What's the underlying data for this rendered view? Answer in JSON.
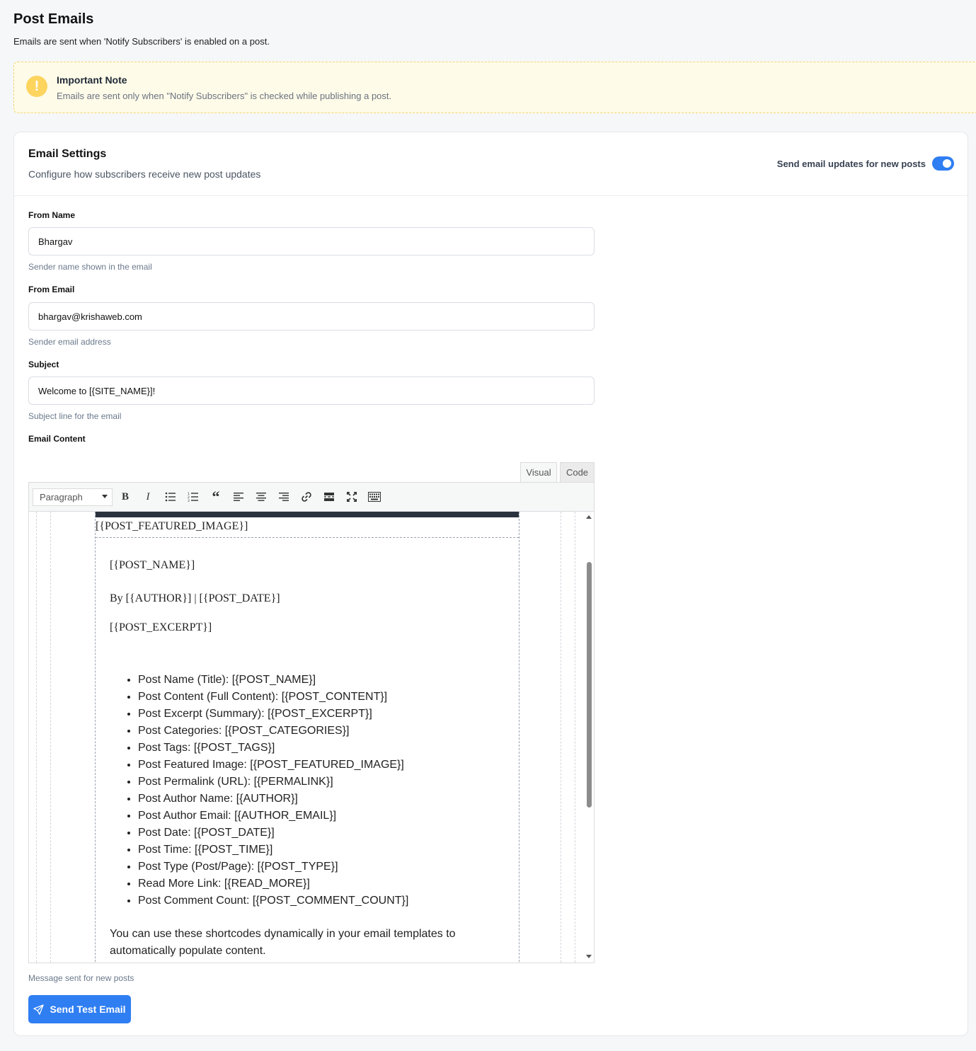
{
  "page": {
    "title": "Post Emails",
    "subtitle": "Emails are sent when 'Notify Subscribers' is enabled on a post."
  },
  "note": {
    "icon": "exclamation-icon",
    "title": "Important Note",
    "text": "Emails are sent only when \"Notify Subscribers\" is checked while publishing a post."
  },
  "settings": {
    "title": "Email Settings",
    "subtitle": "Configure how subscribers receive new post updates",
    "toggle_label": "Send email updates for new posts",
    "toggle_on": true,
    "from_name": {
      "label": "From Name",
      "value": "Bhargav",
      "help": "Sender name shown in the email"
    },
    "from_email": {
      "label": "From Email",
      "value": "bhargav@krishaweb.com",
      "help": "Sender email address"
    },
    "subject": {
      "label": "Subject",
      "value": "Welcome to [{SITE_NAME}]!",
      "help": "Subject line for the email"
    },
    "content": {
      "label": "Email Content",
      "help": "Message sent for new posts"
    }
  },
  "editor": {
    "tabs": {
      "visual": "Visual",
      "code": "Code"
    },
    "format_select": "Paragraph",
    "featured_image": "[{POST_FEATURED_IMAGE}]",
    "post_name": "[{POST_NAME}]",
    "byline": "By [{AUTHOR}] | [{POST_DATE}]",
    "excerpt": "[{POST_EXCERPT}]",
    "shortcodes": [
      "Post Name (Title): [{POST_NAME}]",
      "Post Content (Full Content): [{POST_CONTENT}]",
      "Post Excerpt (Summary): [{POST_EXCERPT}]",
      "Post Categories: [{POST_CATEGORIES}]",
      "Post Tags: [{POST_TAGS}]",
      "Post Featured Image: [{POST_FEATURED_IMAGE}]",
      "Post Permalink (URL): [{PERMALINK}]",
      "Post Author Name: [{AUTHOR}]",
      "Post Author Email: [{AUTHOR_EMAIL}]",
      "Post Date: [{POST_DATE}]",
      "Post Time: [{POST_TIME}]",
      "Post Type (Post/Page): [{POST_TYPE}]",
      "Read More Link: [{READ_MORE}]",
      "Post Comment Count: [{POST_COMMENT_COUNT}]"
    ],
    "footer_text": "You can use these shortcodes dynamically in your email templates to automatically populate content."
  },
  "actions": {
    "send_test": "Send Test Email"
  },
  "colors": {
    "accent": "#2f7ef2",
    "note_bg": "#fefbe8",
    "note_border": "#f3d66c",
    "note_icon": "#fcd45e"
  }
}
